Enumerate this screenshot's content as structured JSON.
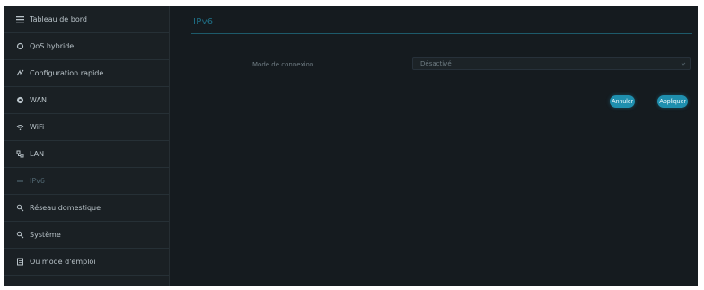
{
  "sidebar": {
    "items": [
      {
        "label": "Tableau de bord",
        "icon": "dashboard-icon"
      },
      {
        "label": "QoS hybride",
        "icon": "qos-icon"
      },
      {
        "label": "Configuration rapide",
        "icon": "quick-setup-icon"
      },
      {
        "label": "WAN",
        "icon": "globe-icon"
      },
      {
        "label": "WiFi",
        "icon": "wifi-icon"
      },
      {
        "label": "LAN",
        "icon": "lan-icon"
      },
      {
        "label": "IPv6",
        "icon": "ipv6-icon",
        "active": true
      },
      {
        "label": "Réseau domestique",
        "icon": "home-network-icon"
      },
      {
        "label": "Système",
        "icon": "system-icon"
      },
      {
        "label": "Ou mode d'emploi",
        "icon": "manual-icon"
      }
    ]
  },
  "main": {
    "title": "IPv6",
    "connection_mode_label": "Mode de connexion",
    "connection_mode_value": "Désactivé",
    "cancel_label": "Annuler",
    "apply_label": "Appliquer"
  },
  "colors": {
    "accent": "#1f8fae",
    "background": "#151b1f",
    "sidebar": "#1a2024"
  }
}
